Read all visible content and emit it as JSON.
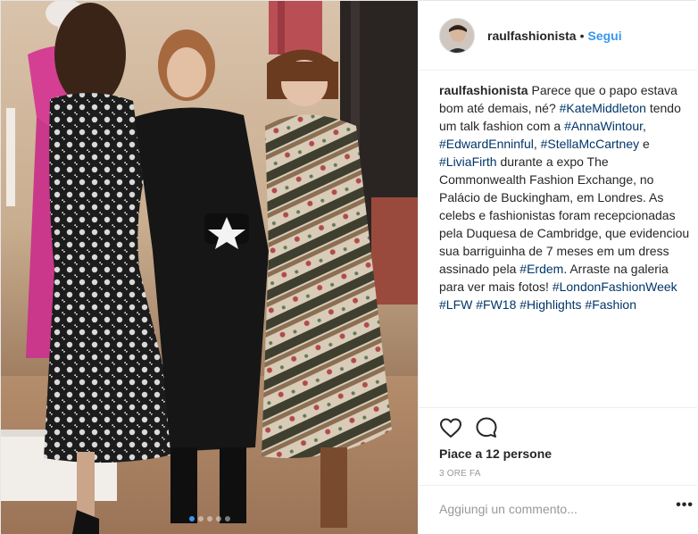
{
  "post": {
    "username": "raulfashionista",
    "separator": "•",
    "follow_label": "Segui",
    "carousel": {
      "slides": 5,
      "active_index": 0
    }
  },
  "caption": {
    "username": "raulfashionista",
    "parts": [
      {
        "t": "text",
        "v": " Parece que o papo estava bom até demais, né? "
      },
      {
        "t": "tag",
        "v": "#KateMiddleton"
      },
      {
        "t": "text",
        "v": " tendo um talk fashion com a "
      },
      {
        "t": "tag",
        "v": "#AnnaWintour"
      },
      {
        "t": "text",
        "v": ", "
      },
      {
        "t": "tag",
        "v": "#EdwardEnninful"
      },
      {
        "t": "text",
        "v": ", "
      },
      {
        "t": "tag",
        "v": "#StellaMcCartney"
      },
      {
        "t": "text",
        "v": " e "
      },
      {
        "t": "tag",
        "v": "#LiviaFirth"
      },
      {
        "t": "text",
        "v": " durante a expo The Commonwealth Fashion Exchange, no Palácio de Buckingham, em Londres. As celebs e fashionistas foram recepcionadas pela Duquesa de Cambridge, que evidenciou sua barriguinha de 7 meses em um dress assinado pela "
      },
      {
        "t": "tag",
        "v": "#Erdem"
      },
      {
        "t": "text",
        "v": ". Arraste na galeria para ver mais fotos! "
      },
      {
        "t": "tag",
        "v": "#LondonFashionWeek"
      },
      {
        "t": "text",
        "v": " "
      },
      {
        "t": "tag",
        "v": "#LFW"
      },
      {
        "t": "text",
        "v": " "
      },
      {
        "t": "tag",
        "v": "#FW18"
      },
      {
        "t": "text",
        "v": " "
      },
      {
        "t": "tag",
        "v": "#Highlights"
      },
      {
        "t": "text",
        "v": " "
      },
      {
        "t": "tag",
        "v": "#Fashion"
      }
    ]
  },
  "actions": {
    "like_icon": "heart-outline-icon",
    "comment_icon": "speech-bubble-icon",
    "likes_text": "Piace a 12 persone",
    "time_text": "3 ORE FA"
  },
  "comment": {
    "placeholder": "Aggiungi un commento...",
    "more_label": "•••"
  },
  "colors": {
    "link_blue": "#3897f0",
    "hashtag": "#003569",
    "muted": "#999999",
    "text": "#262626"
  }
}
